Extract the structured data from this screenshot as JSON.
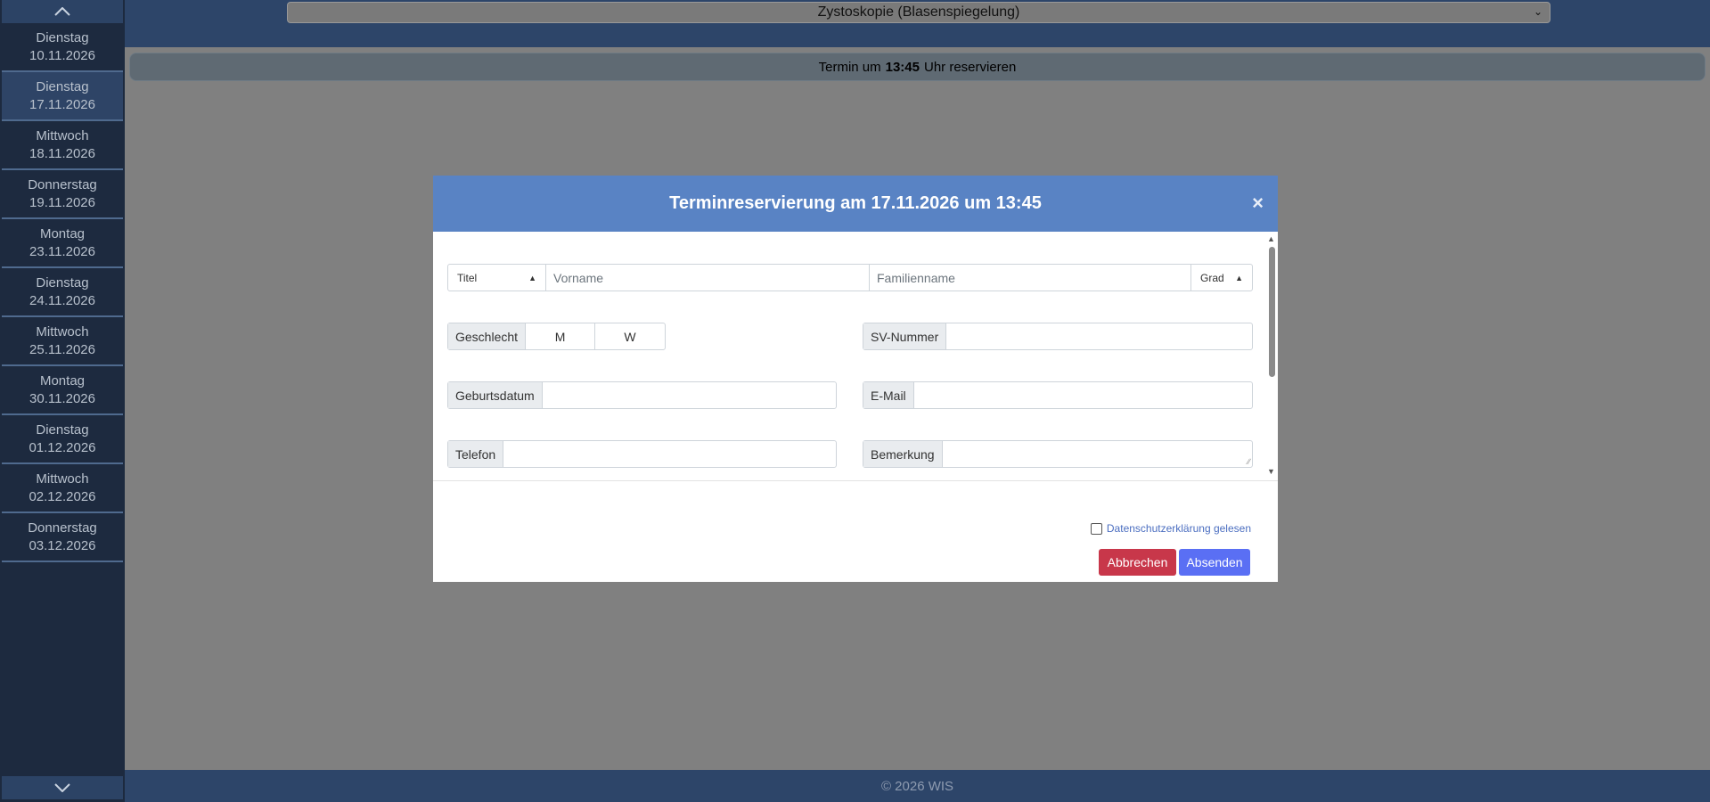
{
  "sidebar": {
    "items": [
      {
        "day": "Dienstag",
        "date": "10.11.2026"
      },
      {
        "day": "Dienstag",
        "date": "17.11.2026"
      },
      {
        "day": "Mittwoch",
        "date": "18.11.2026"
      },
      {
        "day": "Donnerstag",
        "date": "19.11.2026"
      },
      {
        "day": "Montag",
        "date": "23.11.2026"
      },
      {
        "day": "Dienstag",
        "date": "24.11.2026"
      },
      {
        "day": "Mittwoch",
        "date": "25.11.2026"
      },
      {
        "day": "Montag",
        "date": "30.11.2026"
      },
      {
        "day": "Dienstag",
        "date": "01.12.2026"
      },
      {
        "day": "Mittwoch",
        "date": "02.12.2026"
      },
      {
        "day": "Donnerstag",
        "date": "03.12.2026"
      }
    ],
    "active_index": 1
  },
  "topbar": {
    "service_selected": "Zystoskopie (Blasenspiegelung)"
  },
  "reserve_bar": {
    "prefix": "Termin um",
    "time": "13:45",
    "suffix": "Uhr reservieren"
  },
  "modal": {
    "title": "Terminreservierung am 17.11.2026 um 13:45",
    "close_symbol": "×",
    "fields": {
      "titel_select": "Titel",
      "vorname_placeholder": "Vorname",
      "familienname_placeholder": "Familienname",
      "grad_select": "Grad",
      "geschlecht_label": "Geschlecht",
      "gender_m": "M",
      "gender_w": "W",
      "sv_label": "SV-Nummer",
      "geburtsdatum_label": "Geburtsdatum",
      "email_label": "E-Mail",
      "telefon_label": "Telefon",
      "bemerkung_label": "Bemerkung"
    },
    "privacy_label": "Datenschutzerklärung gelesen",
    "cancel_label": "Abbrechen",
    "send_label": "Absenden"
  },
  "footer": {
    "copyright": "© 2026 WIS"
  },
  "colors": {
    "sidebar_bg": "#1d2a3f",
    "topbar_bg": "#2d4569",
    "modal_header": "#5983c4",
    "cancel_button": "#c8374a",
    "send_button": "#5a6ff4"
  }
}
